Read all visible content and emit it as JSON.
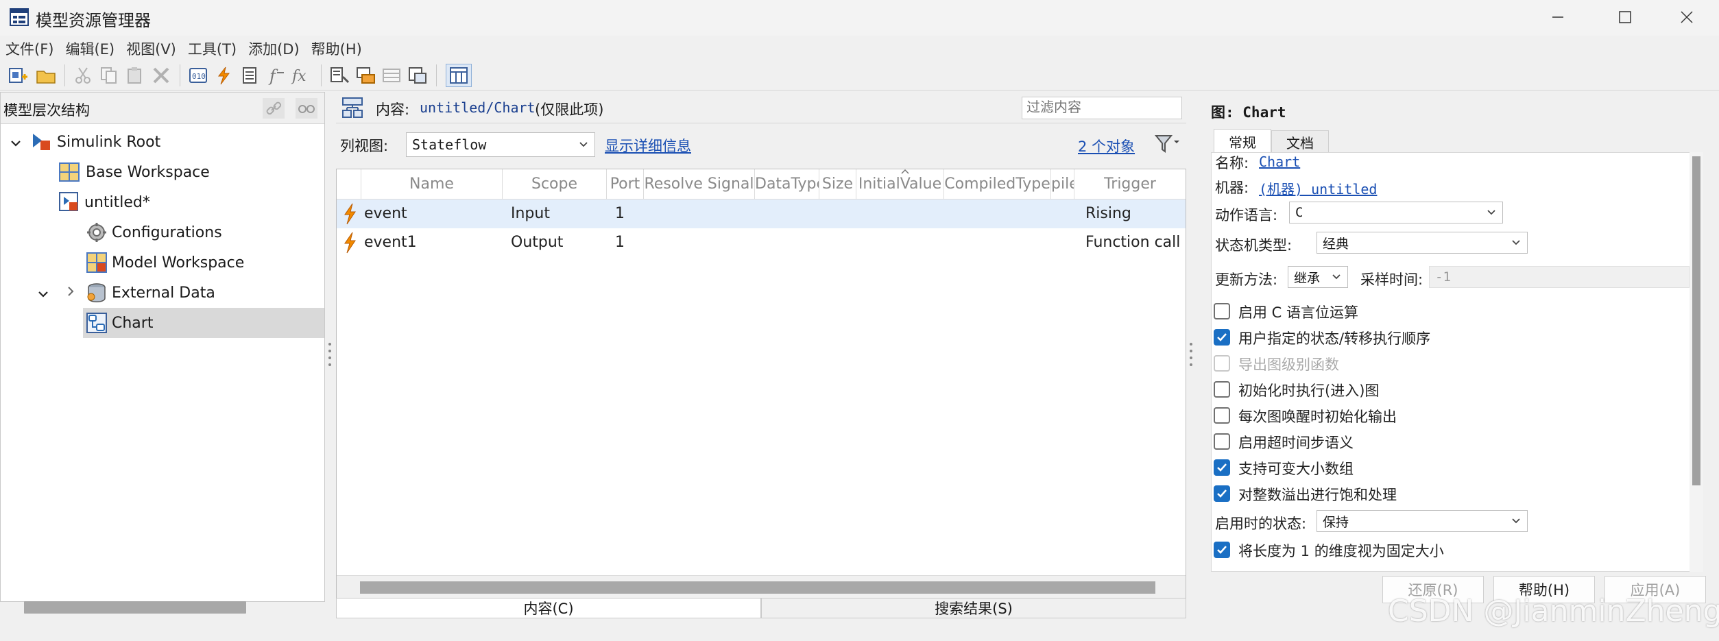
{
  "window": {
    "title": "模型资源管理器"
  },
  "menu": [
    "文件(F)",
    "编辑(E)",
    "视图(V)",
    "工具(T)",
    "添加(D)",
    "帮助(H)"
  ],
  "left": {
    "header": "模型层次结构",
    "tree": [
      {
        "label": "Simulink Root",
        "icon": "simulink-root-icon"
      },
      {
        "label": "Base Workspace",
        "icon": "workspace-icon"
      },
      {
        "label": "untitled*",
        "icon": "model-icon"
      },
      {
        "label": "Configurations",
        "icon": "gear-icon"
      },
      {
        "label": "Model Workspace",
        "icon": "model-workspace-icon"
      },
      {
        "label": "External Data",
        "icon": "database-icon"
      },
      {
        "label": "Chart",
        "icon": "stateflow-chart-icon"
      }
    ]
  },
  "middle": {
    "content_label": "内容:",
    "content_path": "untitled/Chart",
    "content_scope": "(仅限此项)",
    "filter_placeholder": "过滤内容",
    "column_view_label": "列视图:",
    "column_view_value": "Stateflow",
    "show_details": "显示详细信息",
    "object_count": "2 个对象",
    "columns": [
      "Name",
      "Scope",
      "Port",
      "Resolve Signal",
      "DataType",
      "Size",
      "InitialValue",
      "CompiledType",
      "pile",
      "Trigger"
    ],
    "rows": [
      {
        "name": "event",
        "scope": "Input",
        "port": "1",
        "trigger": "Rising"
      },
      {
        "name": "event1",
        "scope": "Output",
        "port": "1",
        "trigger": "Function call"
      }
    ],
    "tabs": [
      "内容(C)",
      "搜索结果(S)"
    ]
  },
  "right": {
    "title": "图: Chart",
    "tabs": [
      "常规",
      "文档"
    ],
    "name_label": "名称:",
    "name_value": "Chart",
    "machine_label": "机器:",
    "machine_value": "(机器) untitled",
    "action_lang_label": "动作语言:",
    "action_lang_value": "C",
    "sm_type_label": "状态机类型:",
    "sm_type_value": "经典",
    "update_label": "更新方法:",
    "update_value": "继承",
    "sample_label": "采样时间:",
    "sample_value": "-1",
    "checkboxes": [
      {
        "label": "启用 C 语言位运算",
        "checked": false,
        "disabled": false
      },
      {
        "label": "用户指定的状态/转移执行顺序",
        "checked": true,
        "disabled": false
      },
      {
        "label": "导出图级别函数",
        "checked": false,
        "disabled": true
      },
      {
        "label": "初始化时执行(进入)图",
        "checked": false,
        "disabled": false
      },
      {
        "label": "每次图唤醒时初始化输出",
        "checked": false,
        "disabled": false
      },
      {
        "label": "启用超时间步语义",
        "checked": false,
        "disabled": false
      },
      {
        "label": "支持可变大小数组",
        "checked": true,
        "disabled": false
      },
      {
        "label": "对整数溢出进行饱和处理",
        "checked": true,
        "disabled": false
      }
    ],
    "enable_state_label": "启用时的状态:",
    "enable_state_value": "保持",
    "last_checkbox": {
      "label": "将长度为 1 的维度视为固定大小",
      "checked": true
    },
    "buttons": [
      "还原(R)",
      "帮助(H)",
      "应用(A)"
    ]
  },
  "watermark": "CSDN @JianminZheng",
  "colors": {
    "accent": "#1a6fc4",
    "selected_row": "#e3eefb",
    "tree_selected": "#d9d9d9",
    "link": "#1a4fb3"
  }
}
